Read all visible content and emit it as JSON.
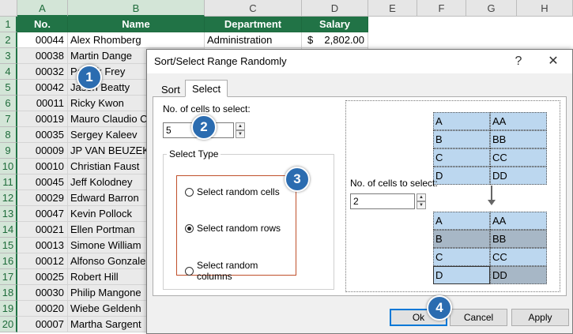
{
  "spreadsheet": {
    "columns": [
      "A",
      "B",
      "C",
      "D",
      "E",
      "F",
      "G",
      "H"
    ],
    "row_numbers": [
      "1",
      "2",
      "3",
      "4",
      "5",
      "6",
      "7",
      "8",
      "9",
      "10",
      "11",
      "12",
      "13",
      "14",
      "15",
      "16",
      "17",
      "18",
      "19",
      "20"
    ],
    "headers": {
      "no": "No.",
      "name": "Name",
      "department": "Department",
      "salary": "Salary"
    },
    "rows": [
      {
        "no": "00044",
        "name": "Alex Rhomberg",
        "department": "Administration",
        "salary_symbol": "$",
        "salary": "2,802.00"
      },
      {
        "no": "00038",
        "name": "Martin Dange",
        "department": "",
        "salary_symbol": "",
        "salary": ""
      },
      {
        "no": "00032",
        "name": "Patrick Frey",
        "department": "",
        "salary_symbol": "",
        "salary": ""
      },
      {
        "no": "00042",
        "name": "Jason Beatty",
        "department": "",
        "salary_symbol": "",
        "salary": ""
      },
      {
        "no": "00011",
        "name": "Ricky Kwon",
        "department": "",
        "salary_symbol": "",
        "salary": ""
      },
      {
        "no": "00019",
        "name": "Mauro Claudio C",
        "department": "",
        "salary_symbol": "",
        "salary": ""
      },
      {
        "no": "00035",
        "name": "Sergey Kaleev",
        "department": "",
        "salary_symbol": "",
        "salary": ""
      },
      {
        "no": "00009",
        "name": "JP VAN BEUZEKO",
        "department": "",
        "salary_symbol": "",
        "salary": ""
      },
      {
        "no": "00010",
        "name": "Christian Faust",
        "department": "",
        "salary_symbol": "",
        "salary": ""
      },
      {
        "no": "00045",
        "name": "Jeff Kolodney",
        "department": "",
        "salary_symbol": "",
        "salary": ""
      },
      {
        "no": "00029",
        "name": "Edward Barron",
        "department": "",
        "salary_symbol": "",
        "salary": ""
      },
      {
        "no": "00047",
        "name": "Kevin Pollock",
        "department": "",
        "salary_symbol": "",
        "salary": ""
      },
      {
        "no": "00021",
        "name": "Ellen Portman",
        "department": "",
        "salary_symbol": "",
        "salary": ""
      },
      {
        "no": "00013",
        "name": "Simone William",
        "department": "",
        "salary_symbol": "",
        "salary": ""
      },
      {
        "no": "00012",
        "name": "Alfonso Gonzale",
        "department": "",
        "salary_symbol": "",
        "salary": ""
      },
      {
        "no": "00025",
        "name": "Robert Hill",
        "department": "",
        "salary_symbol": "",
        "salary": ""
      },
      {
        "no": "00030",
        "name": "Philip Mangone",
        "department": "",
        "salary_symbol": "",
        "salary": ""
      },
      {
        "no": "00020",
        "name": "Wiebe Geldenh",
        "department": "",
        "salary_symbol": "",
        "salary": ""
      },
      {
        "no": "00007",
        "name": "Martha Sargent",
        "department": "",
        "salary_symbol": "",
        "salary": ""
      }
    ]
  },
  "dialog": {
    "title": "Sort/Select Range Randomly",
    "help_label": "?",
    "close_label": "✕",
    "tabs": [
      {
        "label": "Sort",
        "active": false
      },
      {
        "label": "Select",
        "active": true
      }
    ],
    "cells_to_select_label": "No. of cells to select:",
    "cells_to_select_value": "5",
    "select_type_label": "Select Type",
    "options": [
      {
        "label": "Select random cells",
        "selected": false
      },
      {
        "label": "Select random rows",
        "selected": true
      },
      {
        "label": "Select random columns",
        "selected": false
      }
    ],
    "preview": {
      "cells_label": "No. of cells to select:",
      "cells_value": "2",
      "before": [
        [
          "A",
          "AA"
        ],
        [
          "B",
          "BB"
        ],
        [
          "C",
          "CC"
        ],
        [
          "D",
          "DD"
        ]
      ],
      "after": [
        [
          "A",
          "AA"
        ],
        [
          "B",
          "BB"
        ],
        [
          "C",
          "CC"
        ],
        [
          "D",
          "DD"
        ]
      ],
      "after_selected_rows": [
        1,
        3
      ]
    },
    "buttons": {
      "ok": "Ok",
      "cancel": "Cancel",
      "apply": "Apply"
    },
    "step_badges": [
      "1",
      "2",
      "3",
      "4"
    ]
  },
  "colors": {
    "excel_green": "#217346",
    "badge_blue": "#2b6cb0",
    "preview_cell": "#bcd7ef",
    "preview_selected": "#a7b7c6"
  }
}
